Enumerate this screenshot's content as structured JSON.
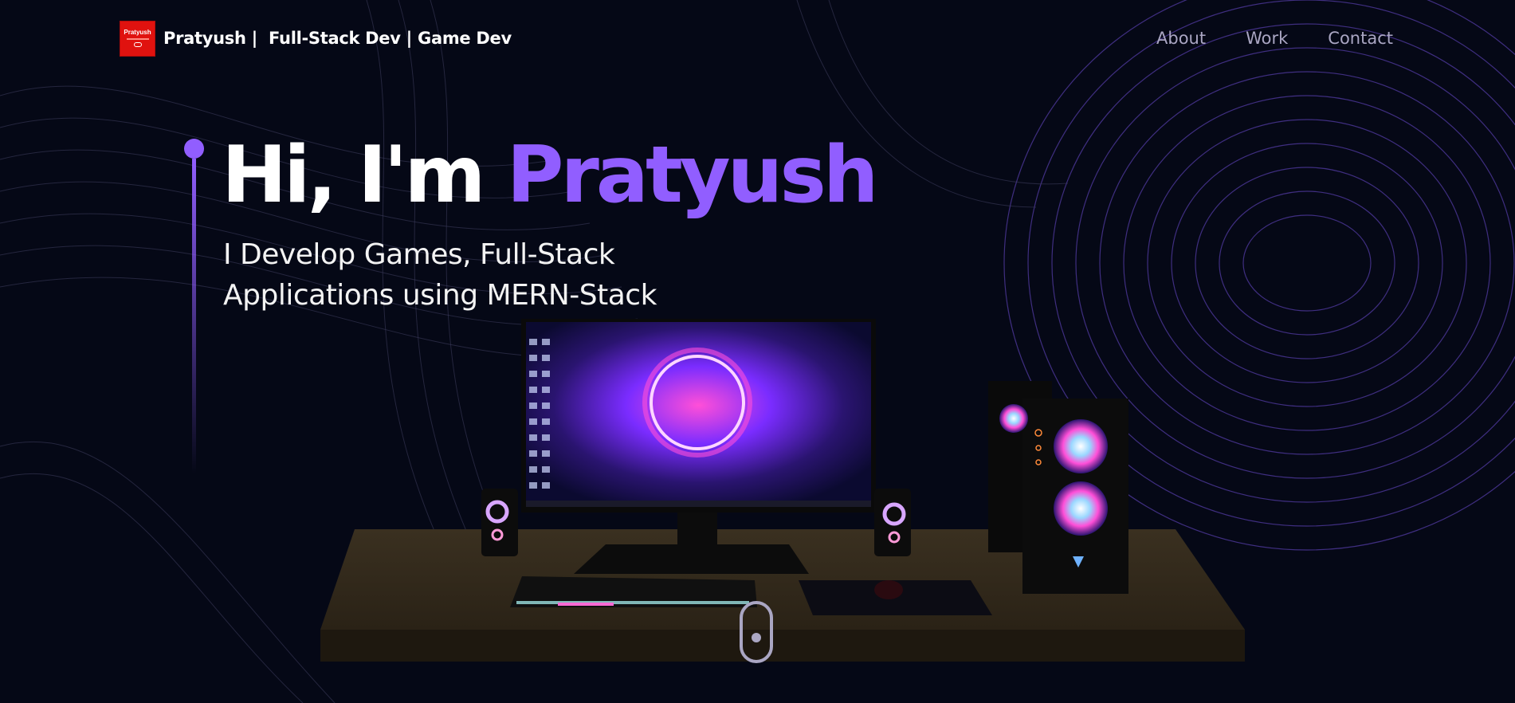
{
  "nav": {
    "logo_text": "Pratyush",
    "brand_title": "Pratyush |  Full-Stack Dev | Game Dev",
    "links": [
      {
        "label": "About"
      },
      {
        "label": "Work"
      },
      {
        "label": "Contact"
      }
    ]
  },
  "hero": {
    "greeting": "Hi, I'm ",
    "name": "Pratyush",
    "subtitle_line1": "I Develop Games, Full-Stack",
    "subtitle_line2": "Applications using MERN-Stack"
  },
  "colors": {
    "background": "#050816",
    "accent": "#915eff",
    "nav_text": "#aaa6c3",
    "logo_red": "#e0120f"
  }
}
